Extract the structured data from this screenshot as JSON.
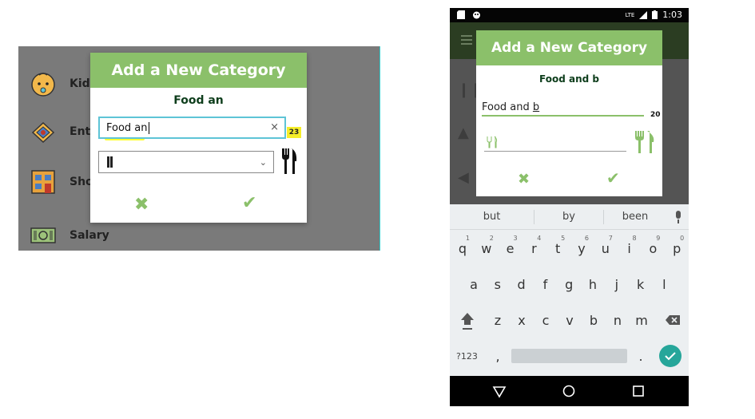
{
  "desktop": {
    "categories": [
      {
        "label": "Kids",
        "icon": "baby-face-icon"
      },
      {
        "label": "Entertainment",
        "icon": "pinata-icon"
      },
      {
        "label": "Shopping",
        "icon": "store-icon"
      },
      {
        "label": "Salary",
        "icon": "money-icon"
      }
    ],
    "visible_labels": [
      "Kids",
      "Ent",
      "Sho",
      "Salary"
    ],
    "dialog": {
      "title": "Add a New Category",
      "preview": "Food an",
      "input_value": "Food an",
      "clear_glyph": "×",
      "char_remaining": "23",
      "select_icon": "cutlery-icon",
      "cancel_glyph": "✖",
      "confirm_glyph": "✔"
    }
  },
  "phone": {
    "status": {
      "time": "1:03",
      "network": "LTE"
    },
    "dialog": {
      "title": "Add a New Category",
      "preview": "Food and b",
      "input_prefix": "Food and ",
      "input_underlined": "b",
      "char_remaining": "20",
      "select_icon": "cutlery-icon",
      "cancel_glyph": "✖",
      "confirm_glyph": "✔"
    },
    "keyboard": {
      "suggestions": [
        "but",
        "by",
        "been"
      ],
      "row1": [
        "q",
        "w",
        "e",
        "r",
        "t",
        "y",
        "u",
        "i",
        "o",
        "p"
      ],
      "row1_digits": [
        "1",
        "2",
        "3",
        "4",
        "5",
        "6",
        "7",
        "8",
        "9",
        "0"
      ],
      "row2": [
        "a",
        "s",
        "d",
        "f",
        "g",
        "h",
        "j",
        "k",
        "l"
      ],
      "row3": [
        "z",
        "x",
        "c",
        "v",
        "b",
        "n",
        "m"
      ],
      "symbols_key": "?123",
      "comma_key": ",",
      "period_key": "."
    },
    "accent_color": "#8bc06a",
    "enter_color": "#26a69a"
  }
}
